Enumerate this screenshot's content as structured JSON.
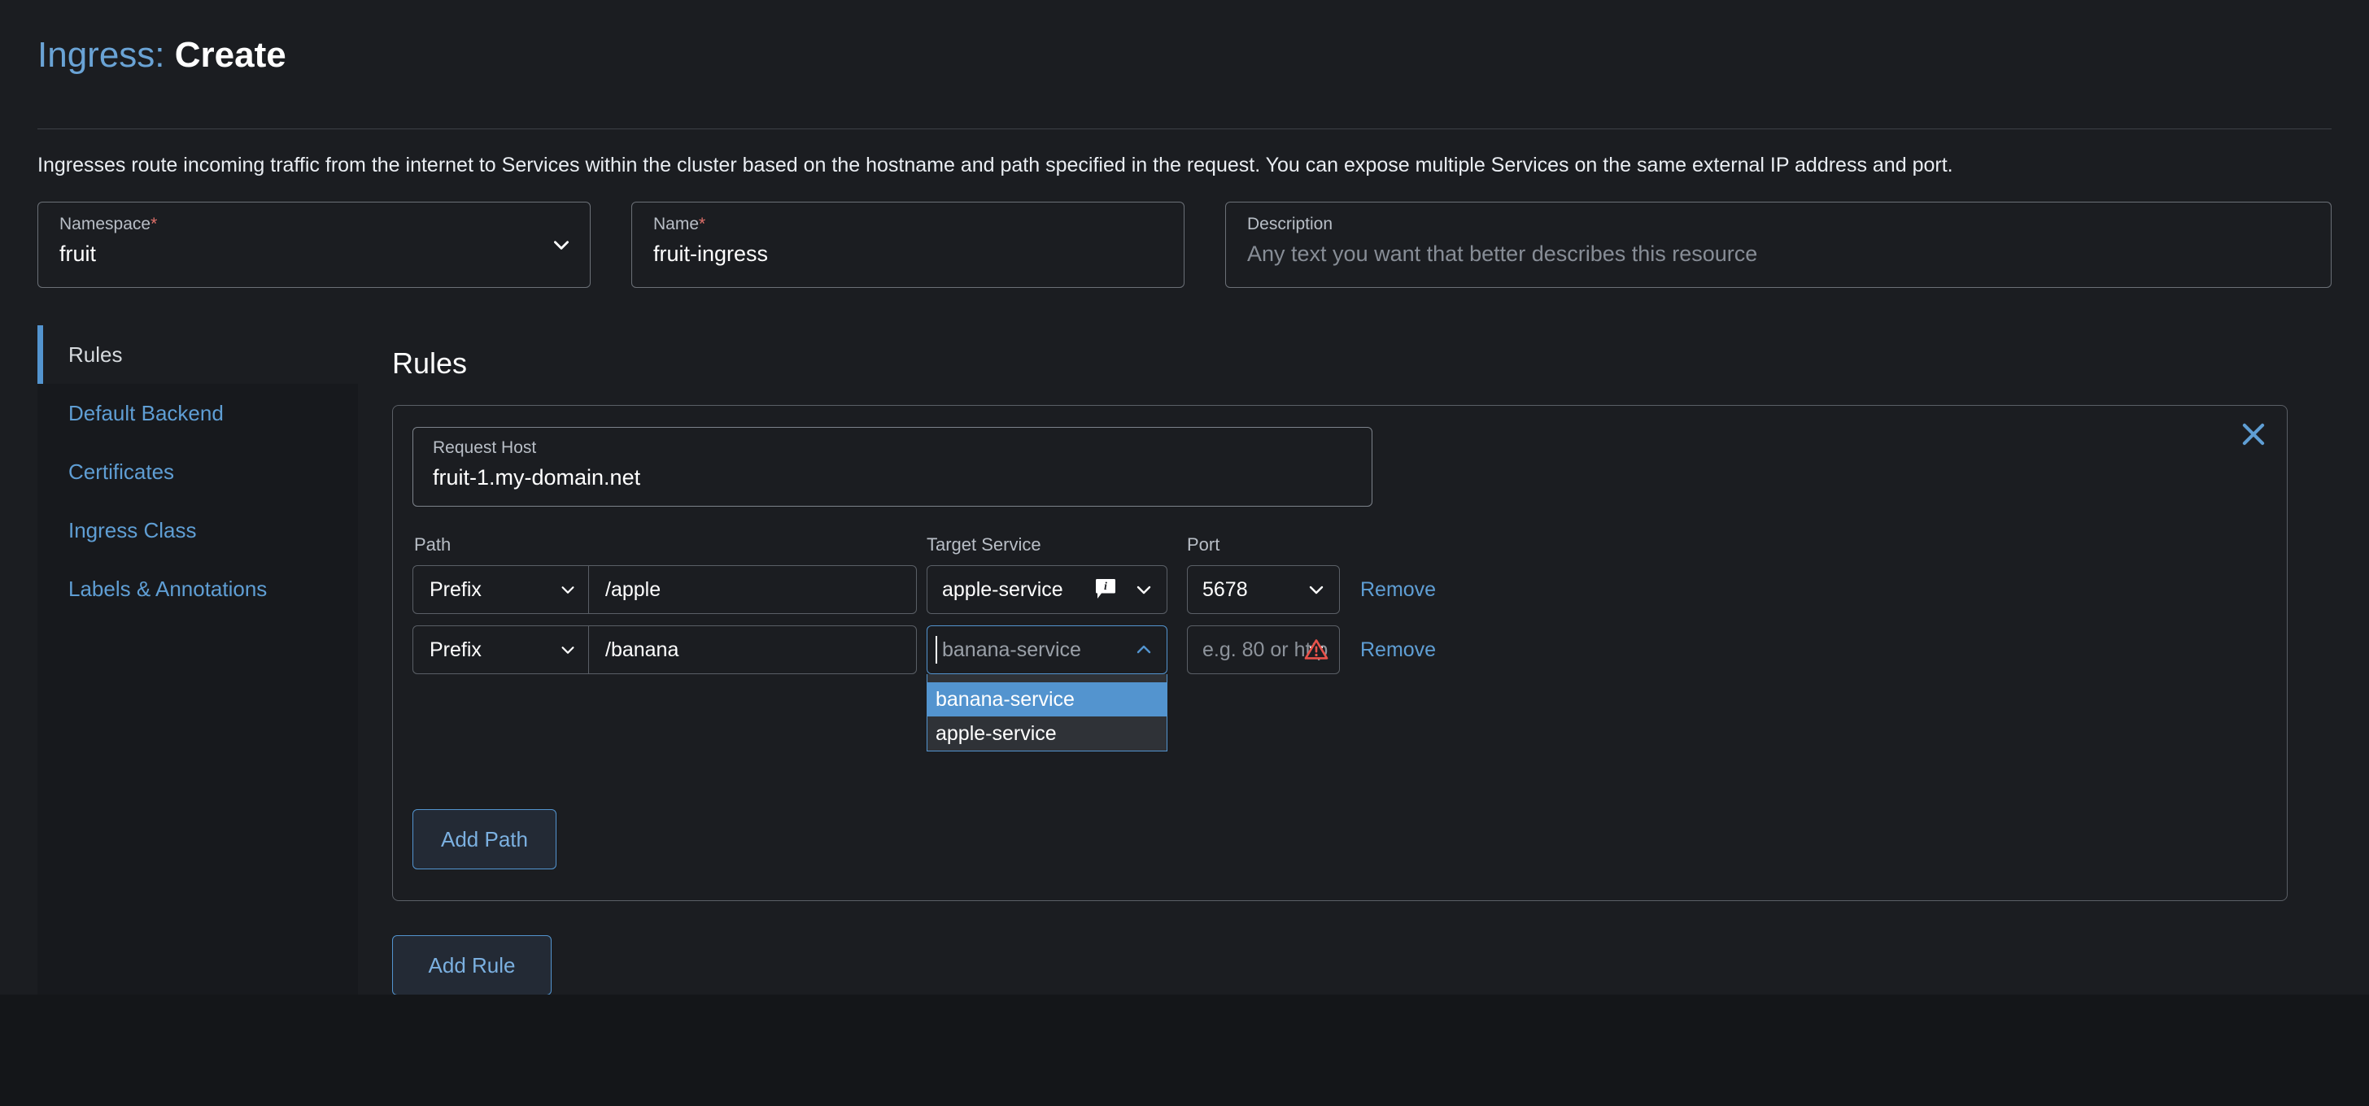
{
  "header": {
    "title_prefix": "Ingress:",
    "title_action": "Create",
    "description": "Ingresses route incoming traffic from the internet to Services within the cluster based on the hostname and path specified in the request. You can expose multiple Services on the same external IP address and port."
  },
  "top_form": {
    "namespace": {
      "label": "Namespace",
      "required_marker": "*",
      "value": "fruit"
    },
    "name": {
      "label": "Name",
      "required_marker": "*",
      "value": "fruit-ingress"
    },
    "description": {
      "label": "Description",
      "placeholder": "Any text you want that better describes this resource"
    }
  },
  "tabs": [
    {
      "label": "Rules",
      "active": true
    },
    {
      "label": "Default Backend",
      "active": false
    },
    {
      "label": "Certificates",
      "active": false
    },
    {
      "label": "Ingress Class",
      "active": false
    },
    {
      "label": "Labels & Annotations",
      "active": false
    }
  ],
  "rules_panel": {
    "heading": "Rules",
    "add_rule_label": "Add Rule",
    "rule": {
      "request_host": {
        "label": "Request Host",
        "value": "fruit-1.my-domain.net"
      },
      "column_headers": {
        "path": "Path",
        "target_service": "Target Service",
        "port": "Port"
      },
      "add_path_label": "Add Path",
      "remove_label": "Remove",
      "paths": [
        {
          "path_type": "Prefix",
          "path_value": "/apple",
          "target_service_value": "apple-service",
          "target_service_placeholder": "",
          "target_open": false,
          "has_info_badge": true,
          "port_value": "5678",
          "port_placeholder": "",
          "port_error": false,
          "remove_label": "Remove"
        },
        {
          "path_type": "Prefix",
          "path_value": "/banana",
          "target_service_value": "",
          "target_service_placeholder": "banana-service",
          "target_open": true,
          "has_info_badge": false,
          "port_value": "",
          "port_placeholder": "e.g. 80 or http",
          "port_error": true,
          "remove_label": "Remove"
        }
      ],
      "target_dropdown_options": [
        {
          "label": "banana-service",
          "highlighted": true
        },
        {
          "label": "apple-service",
          "highlighted": false
        }
      ]
    }
  },
  "colors": {
    "accent_blue": "#5394cf",
    "link_blue": "#5f9ed4",
    "page_bg": "#1b1d21",
    "outer_bg": "#141619",
    "nav_bg": "#17191d",
    "required_red": "#e0706a",
    "warning_red": "#e8524a",
    "dropdown_bg": "#2f3237"
  }
}
